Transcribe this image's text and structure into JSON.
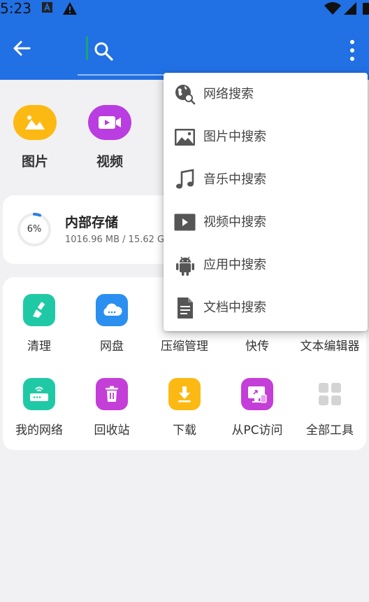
{
  "status_bar": {
    "time": "5:23"
  },
  "quick_access": [
    {
      "label": "图片",
      "icon": "image-icon",
      "color": "#fdb913"
    },
    {
      "label": "视频",
      "icon": "video-icon",
      "color": "#b93de0"
    }
  ],
  "storage": {
    "title": "内部存储",
    "percent_label": "6%",
    "used_fraction": 0.06,
    "detail": "1016.96 MB / 15.62 G"
  },
  "tools_row1": [
    {
      "label": "清理",
      "icon": "clean-brush-icon",
      "color": "#20c9a5"
    },
    {
      "label": "网盘",
      "icon": "cloud-drive-icon",
      "color": "#2b8ff0"
    },
    {
      "label": "压缩管理",
      "icon": "compress-icon",
      "color": "#888888"
    },
    {
      "label": "快传",
      "icon": "quick-transfer-icon",
      "color": "#888888"
    },
    {
      "label": "文本编辑器",
      "icon": "text-editor-icon",
      "color": "#888888"
    }
  ],
  "tools_row2": [
    {
      "label": "我的网络",
      "icon": "router-icon",
      "color": "#20c9a5"
    },
    {
      "label": "回收站",
      "icon": "trash-icon",
      "color": "#c43ed8"
    },
    {
      "label": "下载",
      "icon": "download-icon",
      "color": "#fdb913"
    },
    {
      "label": "从PC访问",
      "icon": "pc-access-icon",
      "color": "#c43ed8"
    },
    {
      "label": "全部工具",
      "icon": "grid-icon",
      "color": "#d4d4d4"
    }
  ],
  "menu": [
    {
      "label": "网络搜索",
      "icon": "globe-search-icon"
    },
    {
      "label": "图片中搜索",
      "icon": "picture-icon"
    },
    {
      "label": "音乐中搜索",
      "icon": "music-note-icon"
    },
    {
      "label": "视频中搜索",
      "icon": "play-icon"
    },
    {
      "label": "应用中搜索",
      "icon": "android-icon"
    },
    {
      "label": "文档中搜索",
      "icon": "document-icon"
    }
  ],
  "colors": {
    "app_bar": "#2170e4",
    "accent_ring": "#2a7de1",
    "background": "#f1f1f3"
  }
}
